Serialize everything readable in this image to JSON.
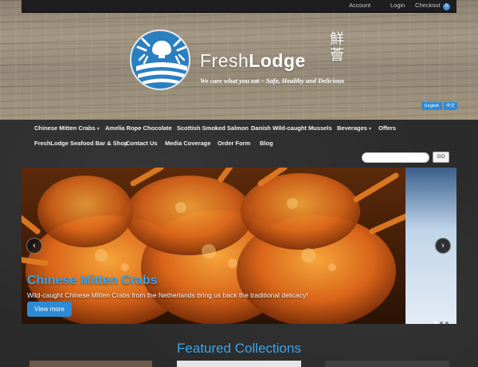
{
  "topbar": {
    "account": "Account",
    "login": "Login",
    "checkout": "Checkout",
    "cart_count": "0"
  },
  "brand": {
    "name_light": "Fresh",
    "name_bold": "Lodge",
    "chinese": "鮮薈",
    "tagline": "We care what you eat – Safe, Healthy and Delicious"
  },
  "language": {
    "english": "English",
    "chinese": "中文"
  },
  "nav": {
    "items": [
      {
        "label": "Chinese Mitten Crabs",
        "dropdown": true
      },
      {
        "label": "Amelia Rope Chocolate",
        "dropdown": false
      },
      {
        "label": "Scottish Smoked Salmon",
        "dropdown": false
      },
      {
        "label": "Danish Wild-caught Mussels",
        "dropdown": false
      },
      {
        "label": "Beverages",
        "dropdown": true
      },
      {
        "label": "Offers",
        "dropdown": false
      },
      {
        "label": "FreshLodge Seafood Bar & Shop",
        "dropdown": false
      },
      {
        "label": "Contact Us",
        "dropdown": false
      },
      {
        "label": "Media Coverage",
        "dropdown": false
      },
      {
        "label": "Order Form",
        "dropdown": false
      },
      {
        "label": "Blog",
        "dropdown": false
      }
    ]
  },
  "search": {
    "placeholder": "",
    "button": "GO"
  },
  "hero": {
    "title": "Chinese Mitten Crabs",
    "subtitle": "Wild-caught Chinese Mitten Crabs from the Netherlands bring us back the traditional delicacy!",
    "button": "View more",
    "prev_icon": "chevron-left-icon",
    "next_icon": "chevron-right-icon",
    "slides": 3,
    "active_slide": 1
  },
  "featured": {
    "heading": "Featured Collections"
  },
  "colors": {
    "accent": "#2d8bd4",
    "title_blue": "#3ba6ea",
    "chalkboard": "#2b2b2b",
    "topbar": "#1e1e1e"
  }
}
